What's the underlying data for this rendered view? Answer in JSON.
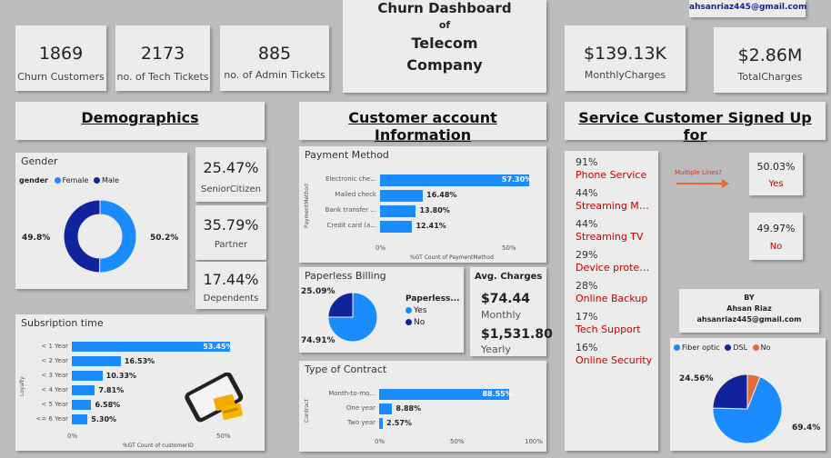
{
  "header": {
    "title_line1": "Churn Dashboard",
    "title_line2": "of",
    "title_line3": "Telecom",
    "title_line4": "Company",
    "email": "ahsanriaz445@gmail.com"
  },
  "kpis": [
    {
      "value": "1869",
      "label": "Churn Customers"
    },
    {
      "value": "2173",
      "label": "no. of Tech Tickets"
    },
    {
      "value": "885",
      "label": "no. of Admin Tickets"
    },
    {
      "value": "$139.13K",
      "label": "MonthlyCharges"
    },
    {
      "value": "$2.86M",
      "label": "TotalCharges"
    }
  ],
  "sections": {
    "demographics": "Demographics",
    "account": "Customer account Information",
    "services": "Service Customer Signed Up for"
  },
  "gender": {
    "title": "Gender",
    "legend_title": "gender",
    "legend": [
      "Female",
      "Male"
    ],
    "left_label": "49.8%",
    "right_label": "50.2%",
    "female_pct": 50.2,
    "male_pct": 49.8,
    "colors": {
      "female": "#1a8cff",
      "male": "#12239e"
    }
  },
  "demo_cards": [
    {
      "value": "25.47%",
      "label": "SeniorCitizen"
    },
    {
      "value": "35.79%",
      "label": "Partner"
    },
    {
      "value": "17.44%",
      "label": "Dependents"
    }
  ],
  "subscription": {
    "title": "Subsription time",
    "axis_y": "Loyalty",
    "axis_x": "%GT Count of customerID",
    "ticks": [
      "0%",
      "50%"
    ],
    "bars": [
      {
        "label": "< 1 Year",
        "value": 53.45,
        "text": "53.45%"
      },
      {
        "label": "< 2 Year",
        "value": 16.53,
        "text": "16.53%"
      },
      {
        "label": "< 3 Year",
        "value": 10.33,
        "text": "10.33%"
      },
      {
        "label": "< 4 Year",
        "value": 7.81,
        "text": "7.81%"
      },
      {
        "label": "< 5 Year",
        "value": 6.58,
        "text": "6.58%"
      },
      {
        "label": "<= 6 Year",
        "value": 5.3,
        "text": "5.30%"
      }
    ]
  },
  "payment": {
    "title": "Payment Method",
    "axis_y": "PaymentMethod",
    "axis_x": "%GT Count of PaymentMethod",
    "ticks": [
      "0%",
      "50%"
    ],
    "bars": [
      {
        "label": "Electronic che...",
        "value": 57.3,
        "text": "57.30%"
      },
      {
        "label": "Mailed check",
        "value": 16.48,
        "text": "16.48%"
      },
      {
        "label": "Bank transfer ...",
        "value": 13.8,
        "text": "13.80%"
      },
      {
        "label": "Credit card (a...",
        "value": 12.41,
        "text": "12.41%"
      }
    ]
  },
  "paperless": {
    "title": "Paperless Billing",
    "legend_title": "Paperless...",
    "legend": [
      "Yes",
      "No"
    ],
    "yes_pct": 74.91,
    "no_pct": 25.09,
    "top_label": "25.09%",
    "bottom_label": "74.91%",
    "colors": {
      "yes": "#1a8cff",
      "no": "#12239e"
    }
  },
  "avg_charges": {
    "title": "Avg. Charges",
    "monthly_value": "$74.44",
    "monthly_label": "Monthly",
    "yearly_value": "$1,531.80",
    "yearly_label": "Yearly"
  },
  "contract": {
    "title": "Type of Contract",
    "axis_y": "Contract",
    "ticks": [
      "0%",
      "50%",
      "100%"
    ],
    "bars": [
      {
        "label": "Month-to-mo...",
        "value": 88.55,
        "text": "88.55%"
      },
      {
        "label": "One year",
        "value": 8.88,
        "text": "8.88%"
      },
      {
        "label": "Two year",
        "value": 2.57,
        "text": "2.57%"
      }
    ]
  },
  "services": [
    {
      "pct": "91%",
      "name": "Phone Service"
    },
    {
      "pct": "44%",
      "name": "Streaming Movi..."
    },
    {
      "pct": "44%",
      "name": "Streaming TV"
    },
    {
      "pct": "29%",
      "name": "Device protecti..."
    },
    {
      "pct": "28%",
      "name": "Online Backup"
    },
    {
      "pct": "17%",
      "name": "Tech Support"
    },
    {
      "pct": "16%",
      "name": "Online Security"
    }
  ],
  "multiple_lines": {
    "label": "Multiple Lines?",
    "yes_value": "50.03%",
    "yes_label": "Yes",
    "no_value": "49.97%",
    "no_label": "No"
  },
  "author": {
    "by": "BY",
    "name": "Ahsan Riaz",
    "email": "ahsanriaz445@gmail.com"
  },
  "internet": {
    "legend": [
      "Fiber optic",
      "DSL",
      "No"
    ],
    "values": [
      69.4,
      24.56,
      6.04
    ],
    "label_left": "24.56%",
    "label_right": "69.4%",
    "colors": [
      "#1a8cff",
      "#12239e",
      "#e66c37"
    ]
  }
}
